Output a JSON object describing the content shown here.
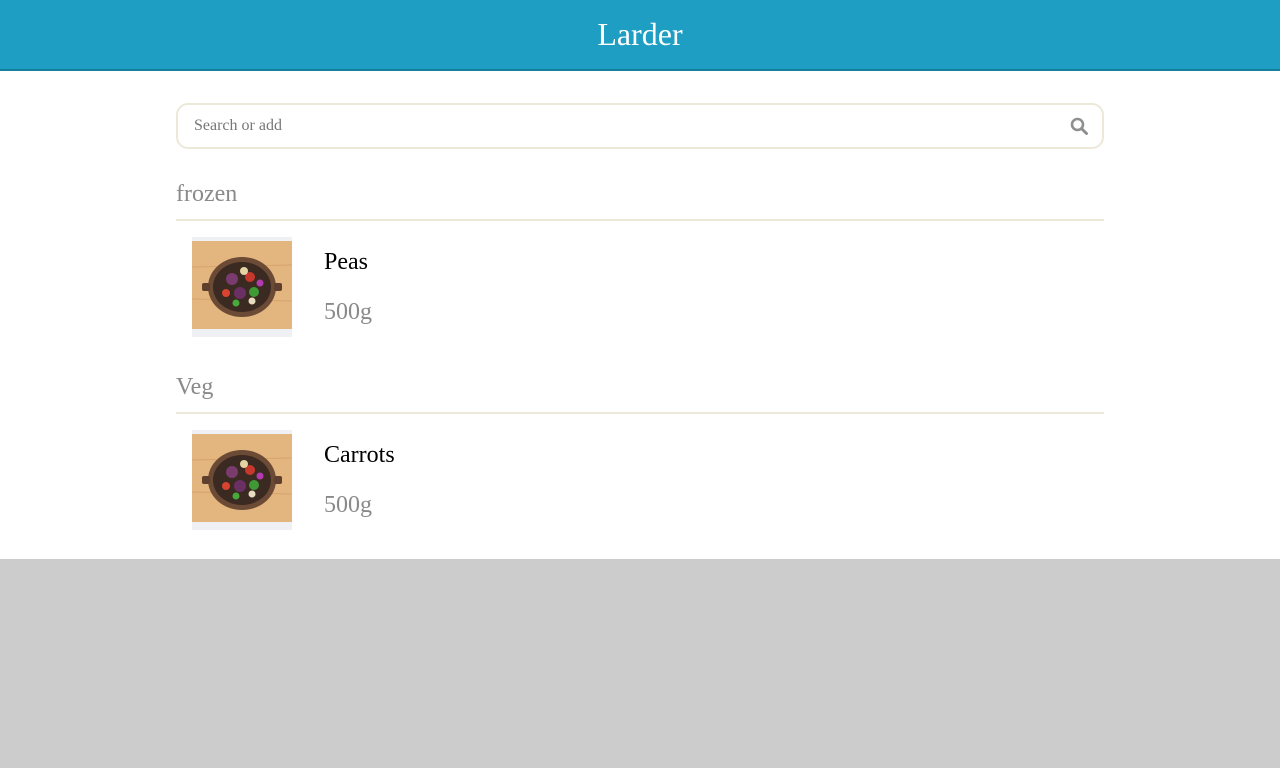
{
  "app": {
    "title": "Larder"
  },
  "search": {
    "placeholder": "Search or add",
    "value": "",
    "icon": "search-icon"
  },
  "categories": [
    {
      "name": "frozen",
      "items": [
        {
          "name": "Peas",
          "quantity": "500g",
          "image": "vegetable-bowl-photo"
        }
      ]
    },
    {
      "name": "Veg",
      "items": [
        {
          "name": "Carrots",
          "quantity": "500g",
          "image": "vegetable-bowl-photo"
        }
      ]
    }
  ],
  "colors": {
    "header": "#1e9ec3",
    "muted_text": "#8a8a8a",
    "divider": "#ece8da",
    "backdrop": "#cccccc"
  }
}
